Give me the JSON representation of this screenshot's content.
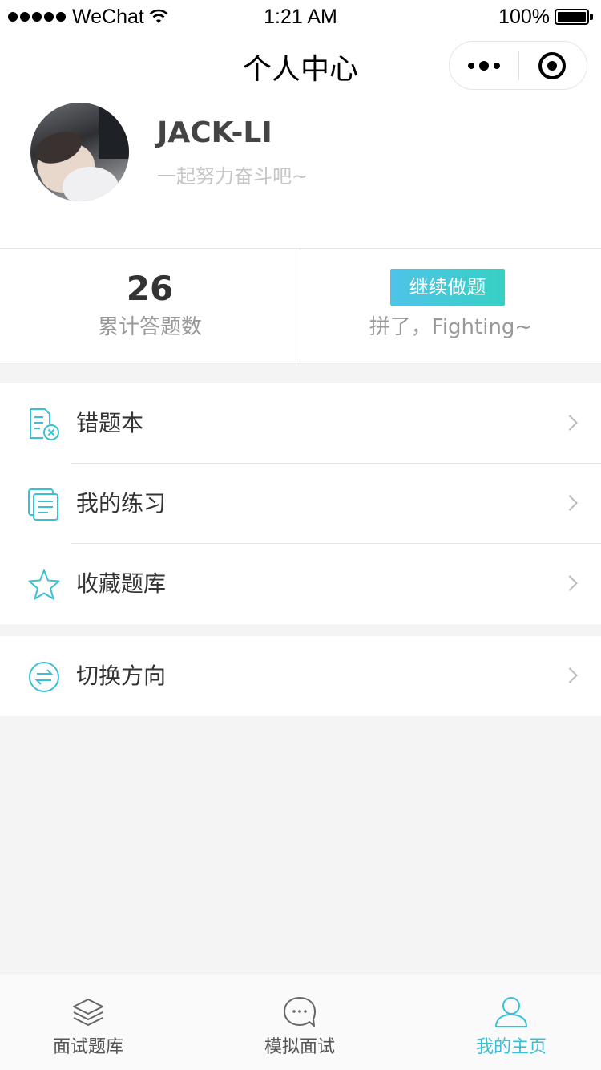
{
  "status_bar": {
    "carrier": "WeChat",
    "time": "1:21 AM",
    "battery": "100%"
  },
  "nav": {
    "title": "个人中心"
  },
  "profile": {
    "name": "JACK-LI",
    "motto": "一起努力奋斗吧~"
  },
  "stats": {
    "total_answered": "26",
    "total_label": "累计答题数",
    "continue_button": "继续做题",
    "fighting_text": "拼了，Fighting~"
  },
  "menu": {
    "items": [
      {
        "label": "错题本",
        "icon": "wrong-notebook-icon"
      },
      {
        "label": "我的练习",
        "icon": "practice-docs-icon"
      },
      {
        "label": "收藏题库",
        "icon": "star-icon"
      },
      {
        "label": "切换方向",
        "icon": "switch-direction-icon"
      }
    ]
  },
  "tabbar": {
    "tabs": [
      {
        "label": "面试题库",
        "icon": "layers-icon",
        "active": false
      },
      {
        "label": "模拟面试",
        "icon": "chat-bubble-icon",
        "active": false
      },
      {
        "label": "我的主页",
        "icon": "user-icon",
        "active": true
      }
    ]
  },
  "colors": {
    "accent": "#38c0d6",
    "button_gradient_start": "#4fc3e8",
    "button_gradient_end": "#36d1c4",
    "background": "#f4f4f4"
  }
}
